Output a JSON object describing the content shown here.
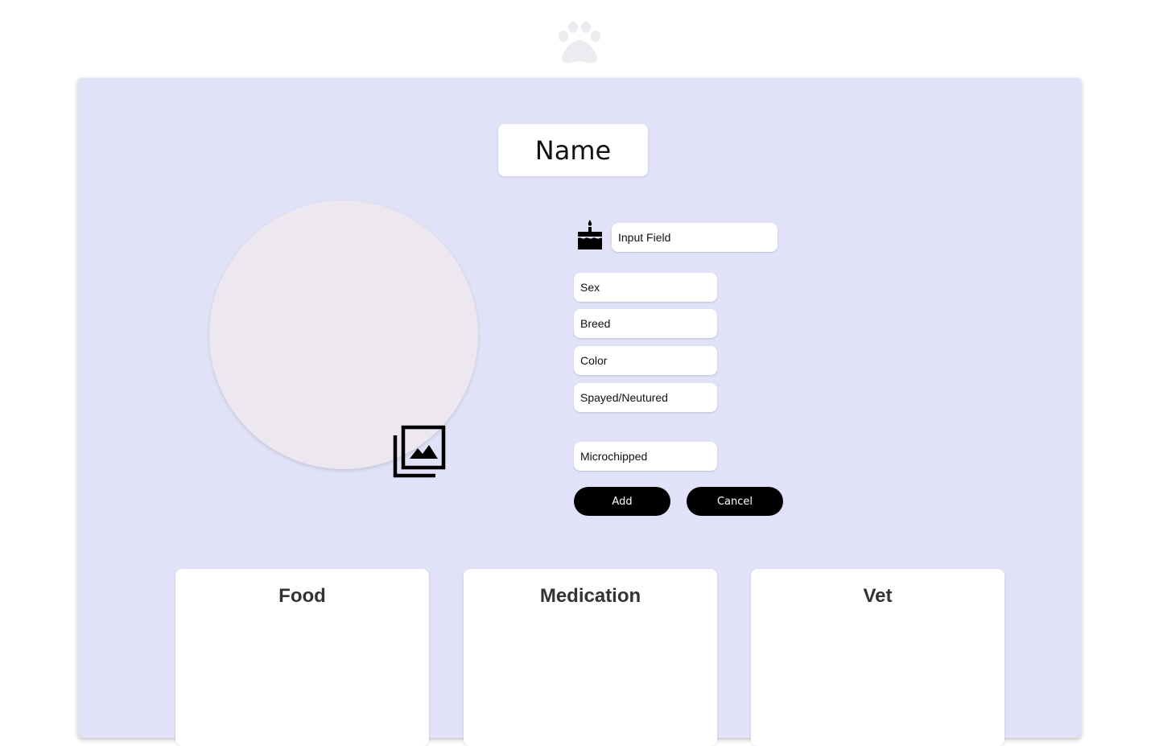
{
  "logo": {
    "icon": "paw-icon",
    "color": "#ebebf0"
  },
  "profile": {
    "name_label": "Name",
    "photo_icon": "photo-library-icon",
    "birthday_icon": "cake-icon",
    "birthday_placeholder": "Input Field",
    "fields": {
      "sex": "Sex",
      "breed": "Breed",
      "color": "Color",
      "spayed_neutered": "Spayed/Neutured",
      "microchipped": "Microchipped"
    },
    "buttons": {
      "add": "Add",
      "cancel": "Cancel"
    }
  },
  "cards": {
    "food": "Food",
    "medication": "Medication",
    "vet": "Vet"
  },
  "colors": {
    "panel_bg": "#e1e1f7",
    "photo_bg": "#ede7f0",
    "button_bg": "#000000"
  }
}
